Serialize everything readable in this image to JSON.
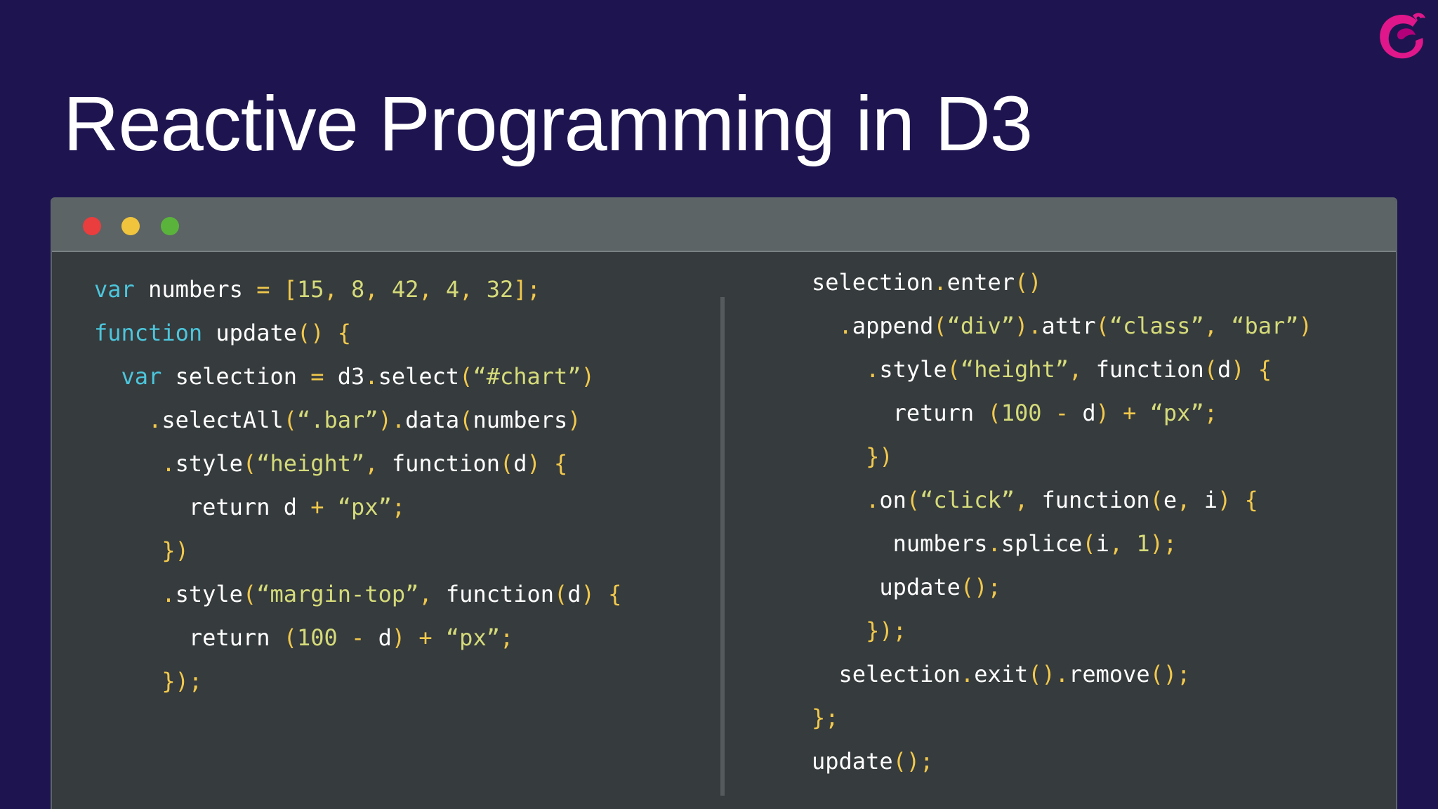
{
  "slide": {
    "title": "Reactive Programming in D3"
  },
  "logo": {
    "icon": "reactivex-logo-icon",
    "colors": {
      "primary": "#e0178a",
      "secondary": "#b3007a"
    }
  },
  "window": {
    "colors": {
      "background": "#363b3d",
      "titlebar": "#5c6466",
      "close": "#ea3d3d",
      "minimize": "#f0c43c",
      "maximize": "#5ab43b"
    }
  },
  "syntax_colors": {
    "keyword": "#4cc6dc",
    "identifier": "#ffffff",
    "string": "#d5db7a",
    "number": "#d5db7a",
    "punctuation": "#f2c94c"
  },
  "code": {
    "left": [
      {
        "indent": 0,
        "tokens": [
          {
            "t": "kw",
            "v": "var"
          },
          {
            "t": "id",
            "v": " numbers "
          },
          {
            "t": "punc",
            "v": "="
          },
          {
            "t": "id",
            "v": " "
          },
          {
            "t": "punc",
            "v": "["
          },
          {
            "t": "num",
            "v": "15"
          },
          {
            "t": "punc",
            "v": ","
          },
          {
            "t": "id",
            "v": " "
          },
          {
            "t": "num",
            "v": "8"
          },
          {
            "t": "punc",
            "v": ","
          },
          {
            "t": "id",
            "v": " "
          },
          {
            "t": "num",
            "v": "42"
          },
          {
            "t": "punc",
            "v": ","
          },
          {
            "t": "id",
            "v": " "
          },
          {
            "t": "num",
            "v": "4"
          },
          {
            "t": "punc",
            "v": ","
          },
          {
            "t": "id",
            "v": " "
          },
          {
            "t": "num",
            "v": "32"
          },
          {
            "t": "punc",
            "v": "];"
          }
        ]
      },
      {
        "indent": 0,
        "tokens": [
          {
            "t": "kw",
            "v": "function"
          },
          {
            "t": "id",
            "v": " update"
          },
          {
            "t": "punc",
            "v": "()"
          },
          {
            "t": "id",
            "v": " "
          },
          {
            "t": "punc",
            "v": "{"
          }
        ]
      },
      {
        "indent": 2,
        "tokens": [
          {
            "t": "kw",
            "v": "var"
          },
          {
            "t": "id",
            "v": " selection "
          },
          {
            "t": "punc",
            "v": "="
          },
          {
            "t": "id",
            "v": " d3"
          },
          {
            "t": "punc",
            "v": "."
          },
          {
            "t": "id",
            "v": "select"
          },
          {
            "t": "punc",
            "v": "("
          },
          {
            "t": "str",
            "v": "“#chart”"
          },
          {
            "t": "punc",
            "v": ")"
          }
        ]
      },
      {
        "indent": 4,
        "tokens": [
          {
            "t": "punc",
            "v": "."
          },
          {
            "t": "id",
            "v": "selectAll"
          },
          {
            "t": "punc",
            "v": "("
          },
          {
            "t": "str",
            "v": "“.bar”"
          },
          {
            "t": "punc",
            "v": ")."
          },
          {
            "t": "id",
            "v": "data"
          },
          {
            "t": "punc",
            "v": "("
          },
          {
            "t": "id",
            "v": "numbers"
          },
          {
            "t": "punc",
            "v": ")"
          }
        ]
      },
      {
        "indent": 5,
        "tokens": [
          {
            "t": "punc",
            "v": "."
          },
          {
            "t": "id",
            "v": "style"
          },
          {
            "t": "punc",
            "v": "("
          },
          {
            "t": "str",
            "v": "“height”"
          },
          {
            "t": "punc",
            "v": ","
          },
          {
            "t": "id",
            "v": " function"
          },
          {
            "t": "punc",
            "v": "("
          },
          {
            "t": "id",
            "v": "d"
          },
          {
            "t": "punc",
            "v": ")"
          },
          {
            "t": "id",
            "v": " "
          },
          {
            "t": "punc",
            "v": "{"
          }
        ]
      },
      {
        "indent": 7,
        "tokens": [
          {
            "t": "id",
            "v": "return d "
          },
          {
            "t": "punc",
            "v": "+"
          },
          {
            "t": "id",
            "v": " "
          },
          {
            "t": "str",
            "v": "“px”"
          },
          {
            "t": "punc",
            "v": ";"
          }
        ]
      },
      {
        "indent": 5,
        "tokens": [
          {
            "t": "punc",
            "v": "})"
          }
        ]
      },
      {
        "indent": 5,
        "tokens": [
          {
            "t": "punc",
            "v": "."
          },
          {
            "t": "id",
            "v": "style"
          },
          {
            "t": "punc",
            "v": "("
          },
          {
            "t": "str",
            "v": "“margin-top”"
          },
          {
            "t": "punc",
            "v": ","
          },
          {
            "t": "id",
            "v": " function"
          },
          {
            "t": "punc",
            "v": "("
          },
          {
            "t": "id",
            "v": "d"
          },
          {
            "t": "punc",
            "v": ")"
          },
          {
            "t": "id",
            "v": " "
          },
          {
            "t": "punc",
            "v": "{"
          }
        ]
      },
      {
        "indent": 7,
        "tokens": [
          {
            "t": "id",
            "v": "return "
          },
          {
            "t": "punc",
            "v": "("
          },
          {
            "t": "num",
            "v": "100"
          },
          {
            "t": "id",
            "v": " "
          },
          {
            "t": "punc",
            "v": "-"
          },
          {
            "t": "id",
            "v": " d"
          },
          {
            "t": "punc",
            "v": ")"
          },
          {
            "t": "id",
            "v": " "
          },
          {
            "t": "punc",
            "v": "+"
          },
          {
            "t": "id",
            "v": " "
          },
          {
            "t": "str",
            "v": "“px”"
          },
          {
            "t": "punc",
            "v": ";"
          }
        ]
      },
      {
        "indent": 5,
        "tokens": [
          {
            "t": "punc",
            "v": "});"
          }
        ]
      }
    ],
    "right": [
      {
        "indent": 0,
        "tokens": [
          {
            "t": "id",
            "v": "selection"
          },
          {
            "t": "punc",
            "v": "."
          },
          {
            "t": "id",
            "v": "enter"
          },
          {
            "t": "punc",
            "v": "()"
          }
        ]
      },
      {
        "indent": 2,
        "tokens": [
          {
            "t": "punc",
            "v": "."
          },
          {
            "t": "id",
            "v": "append"
          },
          {
            "t": "punc",
            "v": "("
          },
          {
            "t": "str",
            "v": "“div”"
          },
          {
            "t": "punc",
            "v": ")."
          },
          {
            "t": "id",
            "v": "attr"
          },
          {
            "t": "punc",
            "v": "("
          },
          {
            "t": "str",
            "v": "“class”"
          },
          {
            "t": "punc",
            "v": ","
          },
          {
            "t": "id",
            "v": " "
          },
          {
            "t": "str",
            "v": "“bar”"
          },
          {
            "t": "punc",
            "v": ")"
          }
        ]
      },
      {
        "indent": 4,
        "tokens": [
          {
            "t": "punc",
            "v": "."
          },
          {
            "t": "id",
            "v": "style"
          },
          {
            "t": "punc",
            "v": "("
          },
          {
            "t": "str",
            "v": "“height”"
          },
          {
            "t": "punc",
            "v": ","
          },
          {
            "t": "id",
            "v": " function"
          },
          {
            "t": "punc",
            "v": "("
          },
          {
            "t": "id",
            "v": "d"
          },
          {
            "t": "punc",
            "v": ")"
          },
          {
            "t": "id",
            "v": " "
          },
          {
            "t": "punc",
            "v": "{"
          }
        ]
      },
      {
        "indent": 6,
        "tokens": [
          {
            "t": "id",
            "v": "return "
          },
          {
            "t": "punc",
            "v": "("
          },
          {
            "t": "num",
            "v": "100"
          },
          {
            "t": "id",
            "v": " "
          },
          {
            "t": "punc",
            "v": "-"
          },
          {
            "t": "id",
            "v": " d"
          },
          {
            "t": "punc",
            "v": ")"
          },
          {
            "t": "id",
            "v": " "
          },
          {
            "t": "punc",
            "v": "+"
          },
          {
            "t": "id",
            "v": " "
          },
          {
            "t": "str",
            "v": "“px”"
          },
          {
            "t": "punc",
            "v": ";"
          }
        ]
      },
      {
        "indent": 4,
        "tokens": [
          {
            "t": "punc",
            "v": "})"
          }
        ]
      },
      {
        "indent": 4,
        "tokens": [
          {
            "t": "punc",
            "v": "."
          },
          {
            "t": "id",
            "v": "on"
          },
          {
            "t": "punc",
            "v": "("
          },
          {
            "t": "str",
            "v": "“click”"
          },
          {
            "t": "punc",
            "v": ","
          },
          {
            "t": "id",
            "v": " function"
          },
          {
            "t": "punc",
            "v": "("
          },
          {
            "t": "id",
            "v": "e"
          },
          {
            "t": "punc",
            "v": ","
          },
          {
            "t": "id",
            "v": " i"
          },
          {
            "t": "punc",
            "v": ")"
          },
          {
            "t": "id",
            "v": " "
          },
          {
            "t": "punc",
            "v": "{"
          }
        ]
      },
      {
        "indent": 6,
        "tokens": [
          {
            "t": "id",
            "v": "numbers"
          },
          {
            "t": "punc",
            "v": "."
          },
          {
            "t": "id",
            "v": "splice"
          },
          {
            "t": "punc",
            "v": "("
          },
          {
            "t": "id",
            "v": "i"
          },
          {
            "t": "punc",
            "v": ","
          },
          {
            "t": "id",
            "v": " "
          },
          {
            "t": "num",
            "v": "1"
          },
          {
            "t": "punc",
            "v": ");"
          }
        ]
      },
      {
        "indent": 5,
        "tokens": [
          {
            "t": "id",
            "v": "update"
          },
          {
            "t": "punc",
            "v": "();"
          }
        ]
      },
      {
        "indent": 4,
        "tokens": [
          {
            "t": "punc",
            "v": "});"
          }
        ]
      },
      {
        "indent": 2,
        "tokens": [
          {
            "t": "id",
            "v": "selection"
          },
          {
            "t": "punc",
            "v": "."
          },
          {
            "t": "id",
            "v": "exit"
          },
          {
            "t": "punc",
            "v": "()."
          },
          {
            "t": "id",
            "v": "remove"
          },
          {
            "t": "punc",
            "v": "();"
          }
        ]
      },
      {
        "indent": 0,
        "tokens": [
          {
            "t": "punc",
            "v": "};"
          }
        ]
      },
      {
        "indent": 0,
        "tokens": [
          {
            "t": "id",
            "v": "update"
          },
          {
            "t": "punc",
            "v": "();"
          }
        ]
      }
    ]
  }
}
